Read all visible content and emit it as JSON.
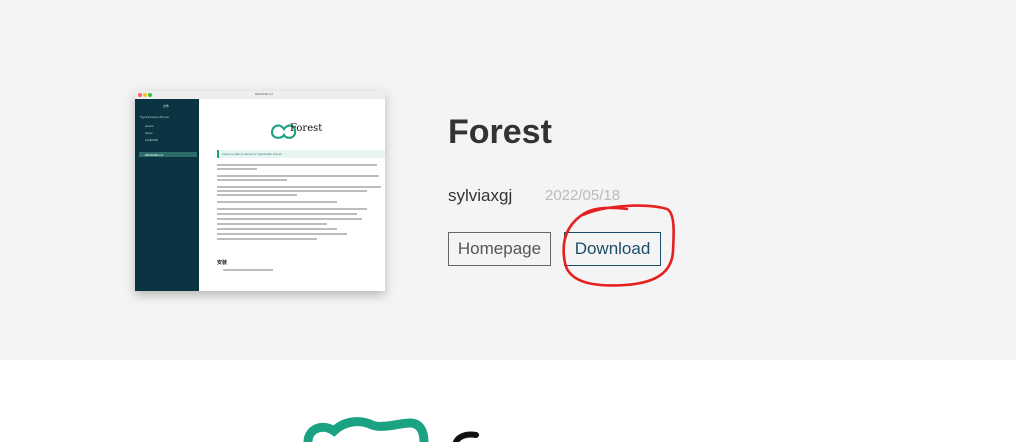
{
  "project": {
    "title": "Forest",
    "author": "sylviaxgj",
    "date": "2022/05/18"
  },
  "buttons": {
    "homepage": "Homepage",
    "download": "Download"
  },
  "preview": {
    "filename": "README.md",
    "sidebar_title": "文件",
    "sidebar_items": [
      "Typora-Forest-Theme",
      "assets",
      "forest",
      "LICENSE",
      "README.md"
    ],
    "logo_text": "Forest",
    "quote": "Forest is plain a theme for Typora like Forest...",
    "section_heading": "安装"
  },
  "colors": {
    "hero_bg": "#f4f4f4",
    "brand_green": "#1aa282",
    "download_blue": "#1d4e67",
    "annotation_red": "#e5201f"
  }
}
